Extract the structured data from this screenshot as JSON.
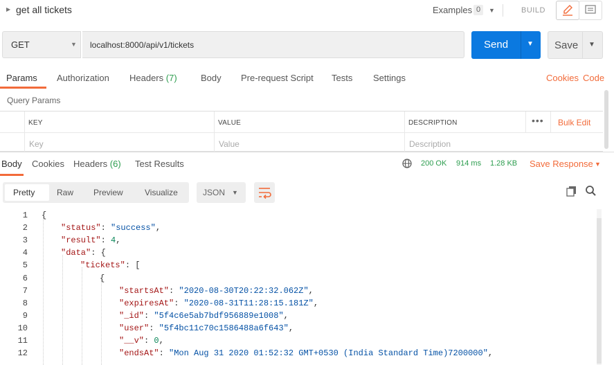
{
  "header": {
    "title": "get all tickets",
    "examples_label": "Examples",
    "examples_count": "0",
    "build_label": "BUILD"
  },
  "request": {
    "method": "GET",
    "url": "localhost:8000/api/v1/tickets",
    "send_label": "Send",
    "save_label": "Save"
  },
  "request_tabs": {
    "params": "Params",
    "authorization": "Authorization",
    "headers": "Headers",
    "headers_count": "(7)",
    "body": "Body",
    "prerequest": "Pre-request Script",
    "tests": "Tests",
    "settings": "Settings",
    "cookies": "Cookies",
    "code": "Code"
  },
  "params": {
    "section_title": "Query Params",
    "columns": {
      "key": "KEY",
      "value": "VALUE",
      "description": "DESCRIPTION"
    },
    "placeholders": {
      "key": "Key",
      "value": "Value",
      "description": "Description"
    },
    "bulk_edit": "Bulk Edit",
    "more": "•••"
  },
  "response_tabs": {
    "body": "Body",
    "cookies": "Cookies",
    "headers": "Headers",
    "headers_count": "(6)",
    "test_results": "Test Results"
  },
  "response_meta": {
    "status": "200 OK",
    "time": "914 ms",
    "size": "1.28 KB",
    "save_response": "Save Response"
  },
  "format_bar": {
    "pretty": "Pretty",
    "raw": "Raw",
    "preview": "Preview",
    "visualize": "Visualize",
    "language": "JSON"
  },
  "code_lines": [
    {
      "num": "1",
      "text": "{"
    },
    {
      "num": "2",
      "key": "\"status\"",
      "val": "\"success\"",
      "vtype": "s",
      "tail": ","
    },
    {
      "num": "3",
      "key": "\"result\"",
      "val": "4",
      "vtype": "n",
      "tail": ","
    },
    {
      "num": "4",
      "key": "\"data\"",
      "val": "{",
      "vtype": "p",
      "tail": ""
    },
    {
      "num": "5",
      "key": "\"tickets\"",
      "val": "[",
      "vtype": "p",
      "tail": ""
    },
    {
      "num": "6",
      "text": "{"
    },
    {
      "num": "7",
      "key": "\"startsAt\"",
      "val": "\"2020-08-30T20:22:32.062Z\"",
      "vtype": "s",
      "tail": ","
    },
    {
      "num": "8",
      "key": "\"expiresAt\"",
      "val": "\"2020-08-31T11:28:15.181Z\"",
      "vtype": "s",
      "tail": ","
    },
    {
      "num": "9",
      "key": "\"_id\"",
      "val": "\"5f4c6e5ab7bdf956889e1008\"",
      "vtype": "s",
      "tail": ","
    },
    {
      "num": "10",
      "key": "\"user\"",
      "val": "\"5f4bc11c70c1586488a6f643\"",
      "vtype": "s",
      "tail": ","
    },
    {
      "num": "11",
      "key": "\"__v\"",
      "val": "0",
      "vtype": "n",
      "tail": ","
    },
    {
      "num": "12",
      "key": "\"endsAt\"",
      "val": "\"Mon Aug 31 2020 01:52:32 GMT+0530 (India Standard Time)7200000\"",
      "vtype": "s",
      "tail": ","
    }
  ],
  "icons": {
    "caret": "caret-right-icon",
    "edit": "pencil-icon",
    "comment": "comment-icon",
    "globe": "globe-icon",
    "wrap": "wrap-lines-icon",
    "copy": "copy-icon",
    "search": "search-icon"
  },
  "colors": {
    "accent": "#f26b3a",
    "send": "#0b79e0",
    "success": "#2d9d4f"
  }
}
